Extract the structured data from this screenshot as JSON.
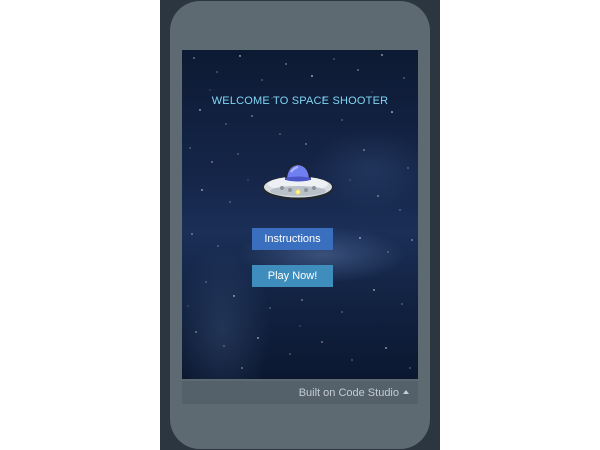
{
  "game": {
    "title": "WELCOME TO SPACE SHOOTER",
    "sprite": "ufo-icon",
    "buttons": {
      "instructions_label": "Instructions",
      "play_label": "Play Now!"
    }
  },
  "footer": {
    "built_on_label": "Built on Code Studio",
    "toggle_icon": "caret-up-icon"
  },
  "colors": {
    "title_text": "#7fd6f5",
    "instructions_button": "#3a6fbf",
    "play_button": "#3e8dbd",
    "phone_body": "#5d6a72",
    "page_frame": "#2b3640",
    "footer_bar": "#54616a"
  }
}
